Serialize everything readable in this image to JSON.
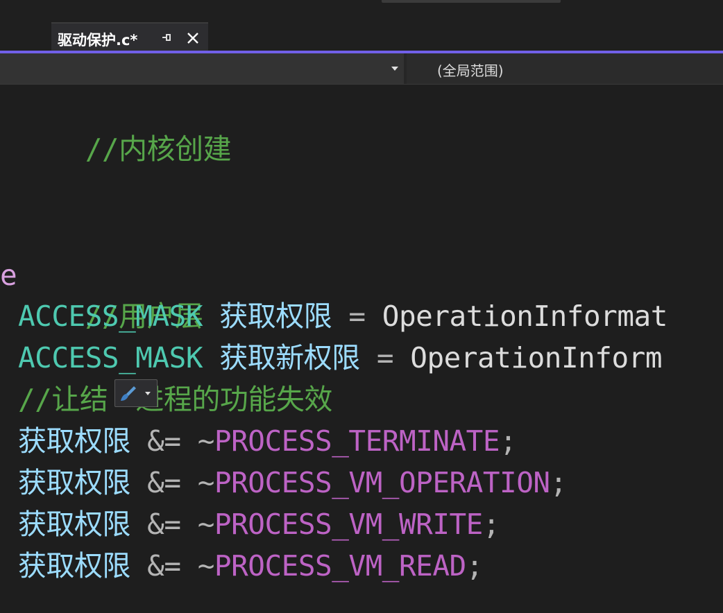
{
  "tab": {
    "label": "驱动保护.c*"
  },
  "navigation": {
    "scope": "(全局范围)"
  },
  "code": {
    "line1": "//内核创建",
    "line2": "e",
    "line3": "//用户层",
    "line4": {
      "type": "ACCESS_MASK",
      "var": "获取权限",
      "op": " = ",
      "rest": "OperationInformat"
    },
    "line5": {
      "type": "ACCESS_MASK",
      "var": "获取新权限",
      "op": " = ",
      "rest": "OperationInform"
    },
    "line6": {
      "part1": "//让结",
      "part2": "进程的功能失效"
    },
    "line7": {
      "var": "获取权限",
      "op": " &= ~",
      "macro": "PROCESS_TERMINATE",
      "end": ";"
    },
    "line8": {
      "var": "获取权限",
      "op": " &= ~",
      "macro": "PROCESS_VM_OPERATION",
      "end": ";"
    },
    "line9": {
      "var": "获取权限",
      "op": " &= ~",
      "macro": "PROCESS_VM_WRITE",
      "end": ";"
    },
    "line10": {
      "var": "获取权限",
      "op": " &= ~",
      "macro": "PROCESS_VM_READ",
      "end": ";"
    }
  },
  "icons": {
    "pin": "pin-icon",
    "close": "close-icon",
    "dropdown": "chevron-down-icon",
    "quick_action": "paintbrush-icon"
  },
  "colors": {
    "accent": "#7160e8",
    "comment": "#57a64a",
    "type": "#4ec9b0",
    "variable": "#9cdcfe",
    "macro": "#bd63c5",
    "background": "#1e1e1e"
  }
}
